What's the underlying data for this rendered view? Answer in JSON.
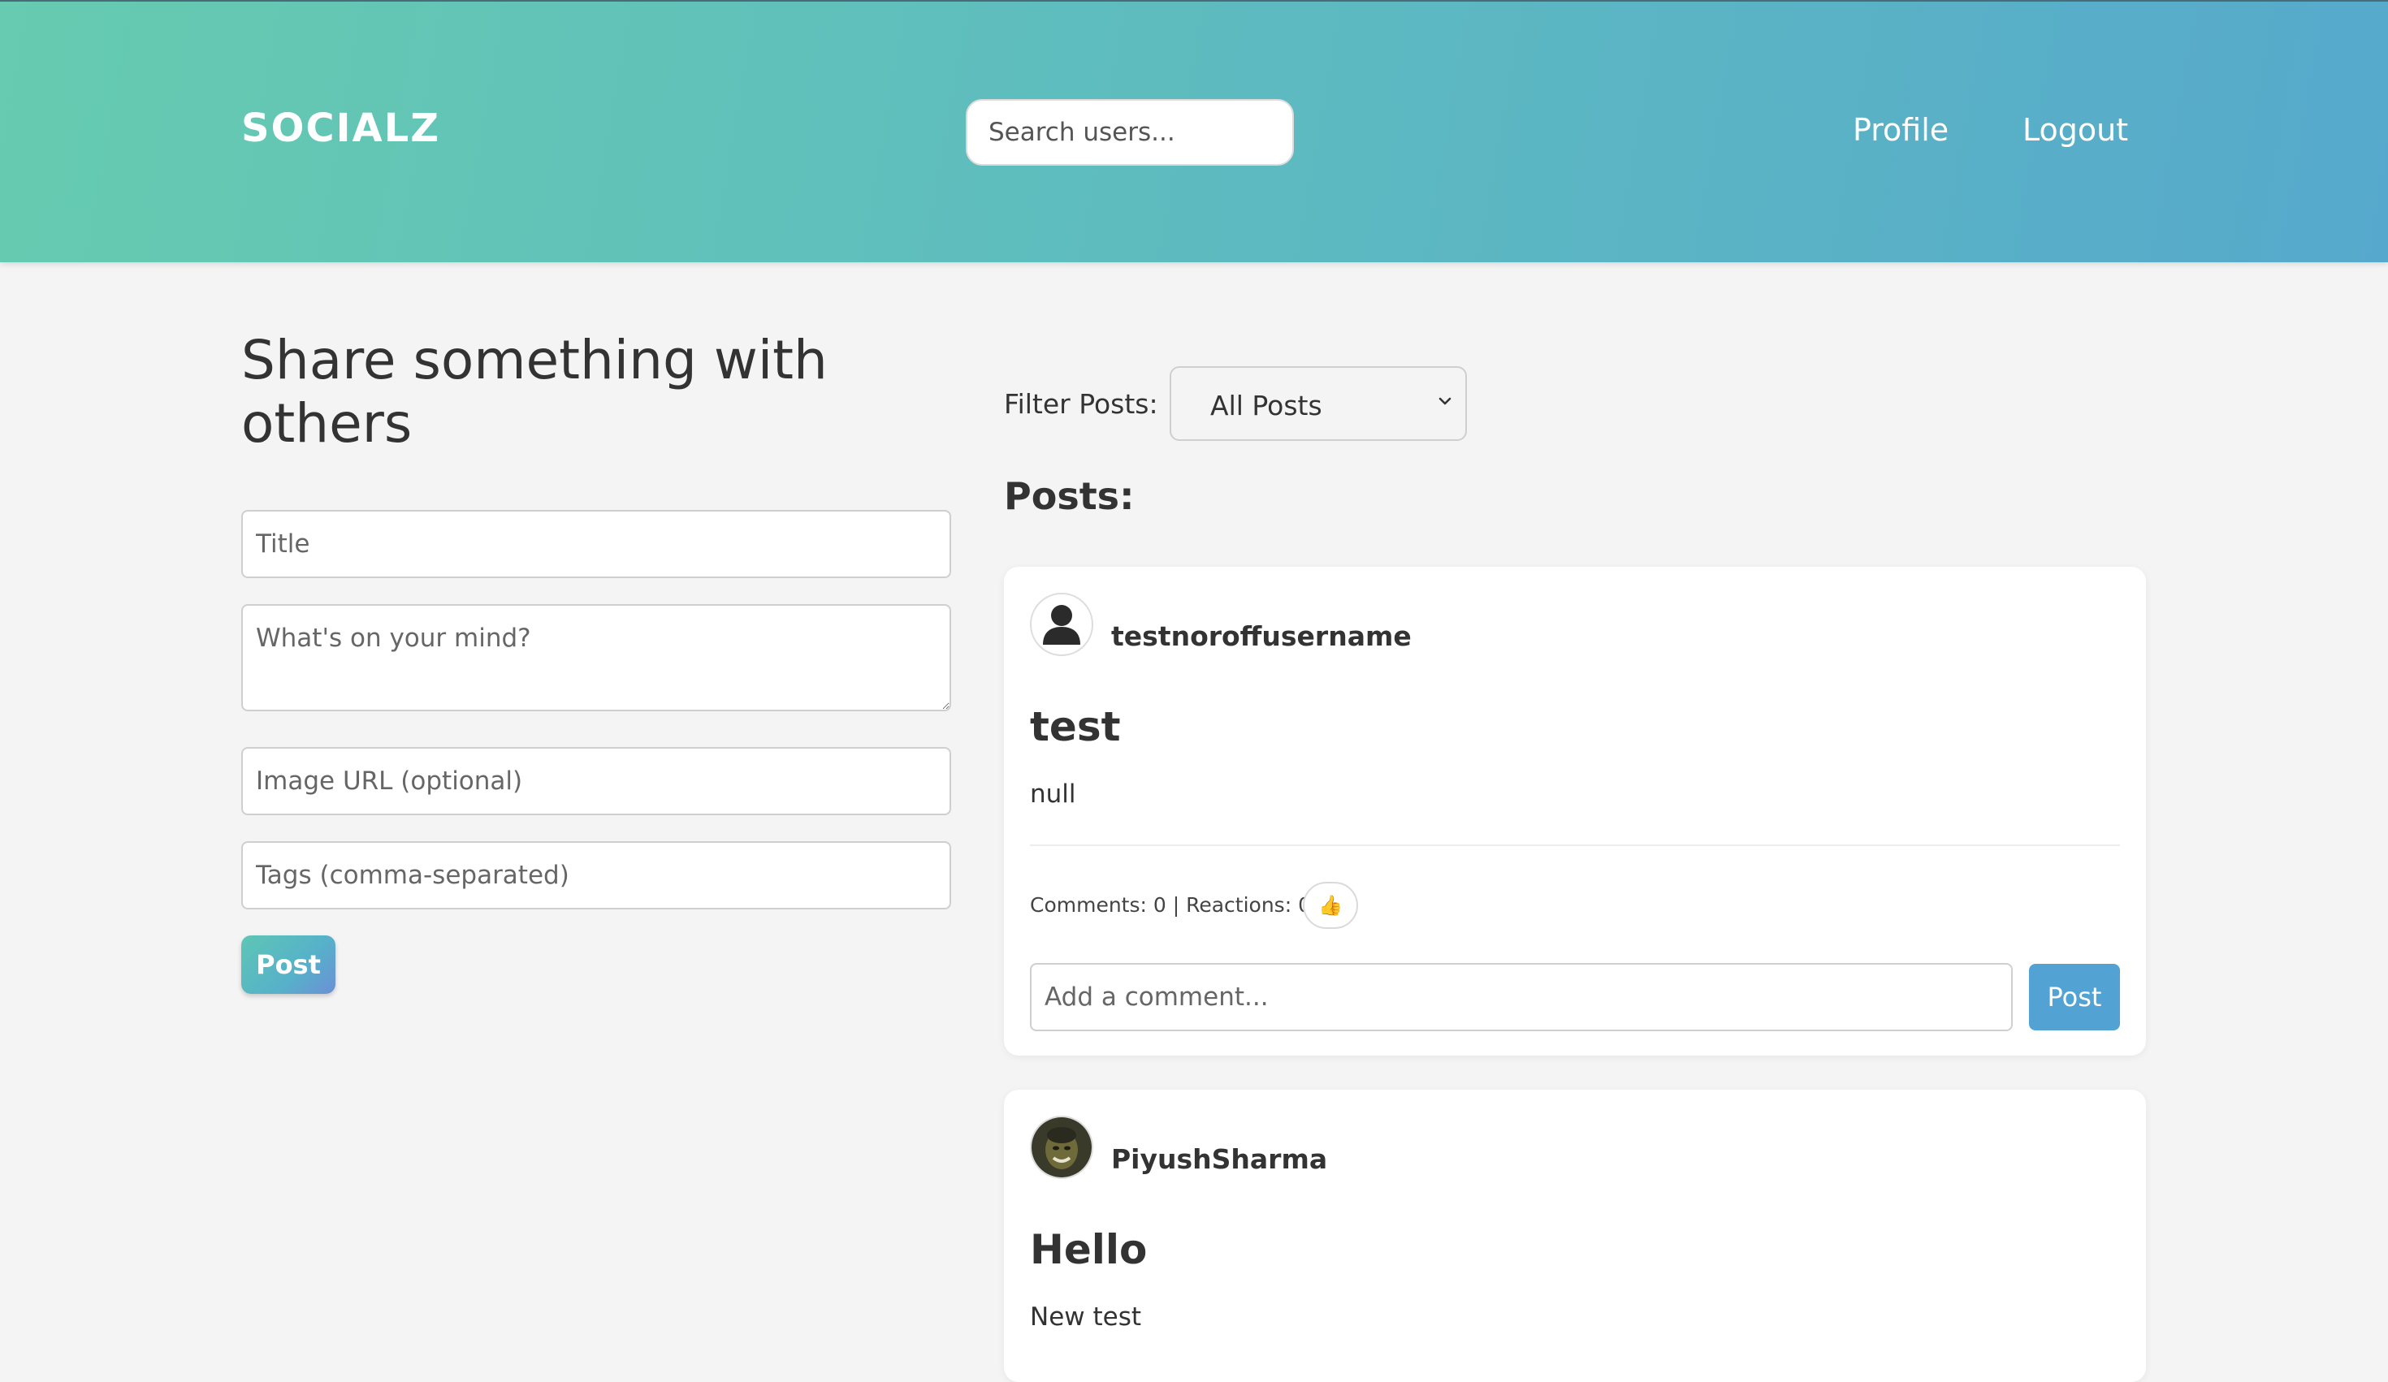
{
  "header": {
    "logo": "SOCIALZ",
    "search_placeholder": "Search users...",
    "nav": {
      "profile": "Profile",
      "logout": "Logout"
    }
  },
  "create_post": {
    "heading": "Share something with others",
    "title_placeholder": "Title",
    "body_placeholder": "What's on your mind?",
    "image_placeholder": "Image URL (optional)",
    "tags_placeholder": "Tags (comma-separated)",
    "submit_label": "Post"
  },
  "feed": {
    "filter_label": "Filter Posts:",
    "filter_selected": "All Posts",
    "posts_heading": "Posts:",
    "posts": [
      {
        "username": "testnoroffusername",
        "avatar_icon": "default-user-icon",
        "title": "test",
        "body": "null",
        "stats": "Comments: 0 | Reactions: 0",
        "reaction_icon": "thumbs-up-icon",
        "reaction_emoji": "👍",
        "comment_placeholder": "Add a comment...",
        "comment_button": "Post"
      },
      {
        "username": "PiyushSharma",
        "avatar_icon": "profile-photo",
        "title": "Hello",
        "body": "New test"
      }
    ]
  },
  "colors": {
    "header_gradient_start": "#66cbb0",
    "header_gradient_end": "#56a9cc",
    "comment_button": "#52a3d4",
    "page_background": "#f4f4f4"
  }
}
